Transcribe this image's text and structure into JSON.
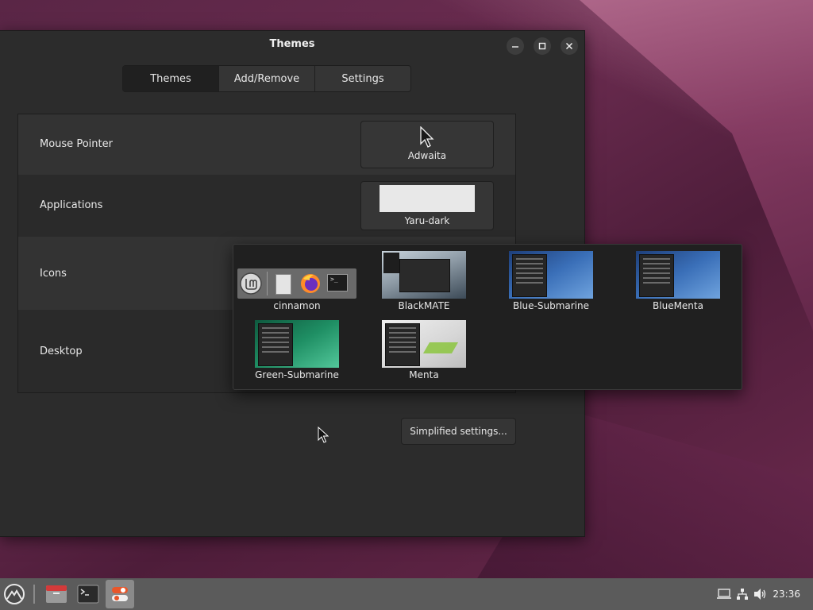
{
  "window": {
    "title": "Themes",
    "minimize_icon": "minimize-icon",
    "maximize_icon": "maximize-icon",
    "close_icon": "close-icon"
  },
  "tabs": [
    {
      "label": "Themes",
      "active": true
    },
    {
      "label": "Add/Remove",
      "active": false
    },
    {
      "label": "Settings",
      "active": false
    }
  ],
  "rows": {
    "mouse_pointer": {
      "label": "Mouse Pointer",
      "value": "Adwaita"
    },
    "applications": {
      "label": "Applications",
      "value": "Yaru-dark"
    },
    "icons": {
      "label": "Icons"
    },
    "desktop": {
      "label": "Desktop"
    }
  },
  "simplified_settings_label": "Simplified settings...",
  "theme_popup": {
    "items": [
      {
        "name": "cinnamon"
      },
      {
        "name": "BlackMATE"
      },
      {
        "name": "Blue-Submarine"
      },
      {
        "name": "BlueMenta"
      },
      {
        "name": "Green-Submarine"
      },
      {
        "name": "Menta"
      }
    ]
  },
  "taskbar": {
    "clock": "23:36",
    "apps": [
      "menu-icon",
      "files-icon",
      "terminal-icon",
      "themes-settings-icon"
    ],
    "tray": [
      "display-icon",
      "network-icon",
      "volume-icon"
    ]
  },
  "colors": {
    "panel_bg": "#5b5b5b",
    "window_bg": "#2c2c2c",
    "accent": "#e8562a"
  }
}
